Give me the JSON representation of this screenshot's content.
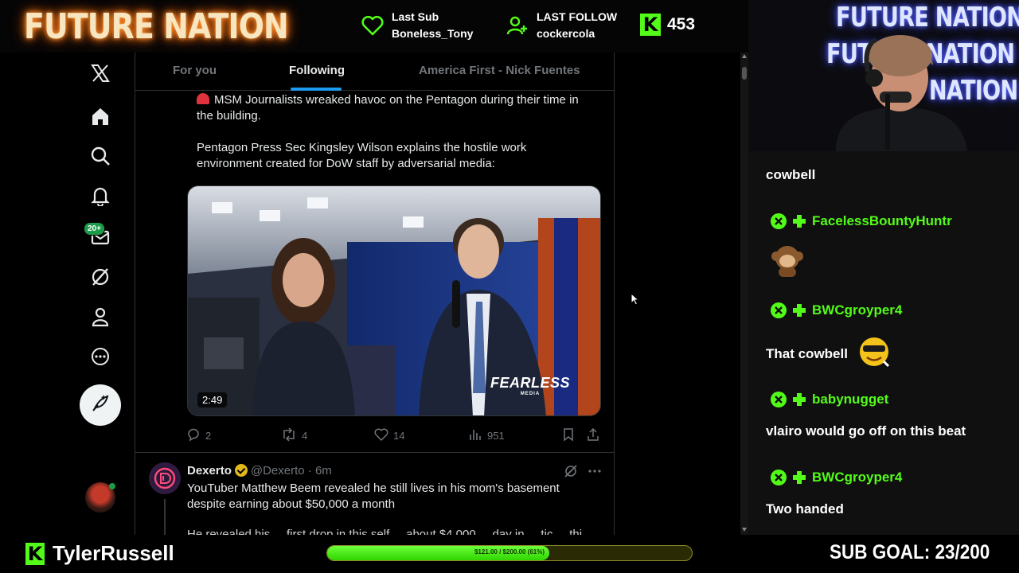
{
  "overlay": {
    "logo": "FUTURE NATION",
    "last_sub_label": "Last Sub",
    "last_sub_name": "Boneless_Tony",
    "last_follow_label": "LAST FOLLOW",
    "last_follow_name": "cockercola",
    "kick_follower_count": "453",
    "webcam_neon": [
      "FUTURE NATION",
      "FUTURE NATION",
      "NATION"
    ],
    "streamer_name": "TylerRussell",
    "goal_progress_text": "$121.00 / $200.00 (61%)",
    "goal_progress": 0.61,
    "sub_goal": "SUB GOAL: 23/200",
    "colors": {
      "kick_green": "#53fc18",
      "logo_glow": "#ff7a1a"
    }
  },
  "x": {
    "tabs": [
      {
        "label": "For you"
      },
      {
        "label": "Following"
      },
      {
        "label": "America First - Nick Fuentes"
      }
    ],
    "nav": {
      "messages_badge": "20+"
    },
    "tweet1": {
      "text1": "MSM Journalists wreaked havoc on the Pentagon during their time in the building.",
      "text2": "Pentagon Press Sec Kingsley Wilson explains the hostile work environment created for DoW staff by adversarial media:",
      "video_duration": "2:49",
      "video_watermark": "FEARLESS",
      "video_watermark_sub": "MEDIA",
      "replies": "2",
      "reposts": "4",
      "likes": "14",
      "views": "951"
    },
    "tweet2": {
      "name": "Dexerto",
      "handle": "@Dexerto",
      "time": "· 6m",
      "text": "YouTuber Matthew Beem revealed he still lives in his mom's basement despite earning about $50,000 a month",
      "cut_text": "He revealed his ... first drop in this self ... about $4,000 ... day in ... tic ... thi"
    }
  },
  "chat": {
    "messages": [
      {
        "user": "",
        "text": "cowbell"
      },
      {
        "user": "FacelessBountyHuntr",
        "text": "",
        "emote": "monkey-emote"
      },
      {
        "user": "BWCgroyper4",
        "text": "That cowbell",
        "emote": "cool-face-emote"
      },
      {
        "user": "babynugget",
        "text": "vlairo would go off on this beat"
      },
      {
        "user": "BWCgroyper4",
        "text": "Two handed"
      }
    ]
  }
}
